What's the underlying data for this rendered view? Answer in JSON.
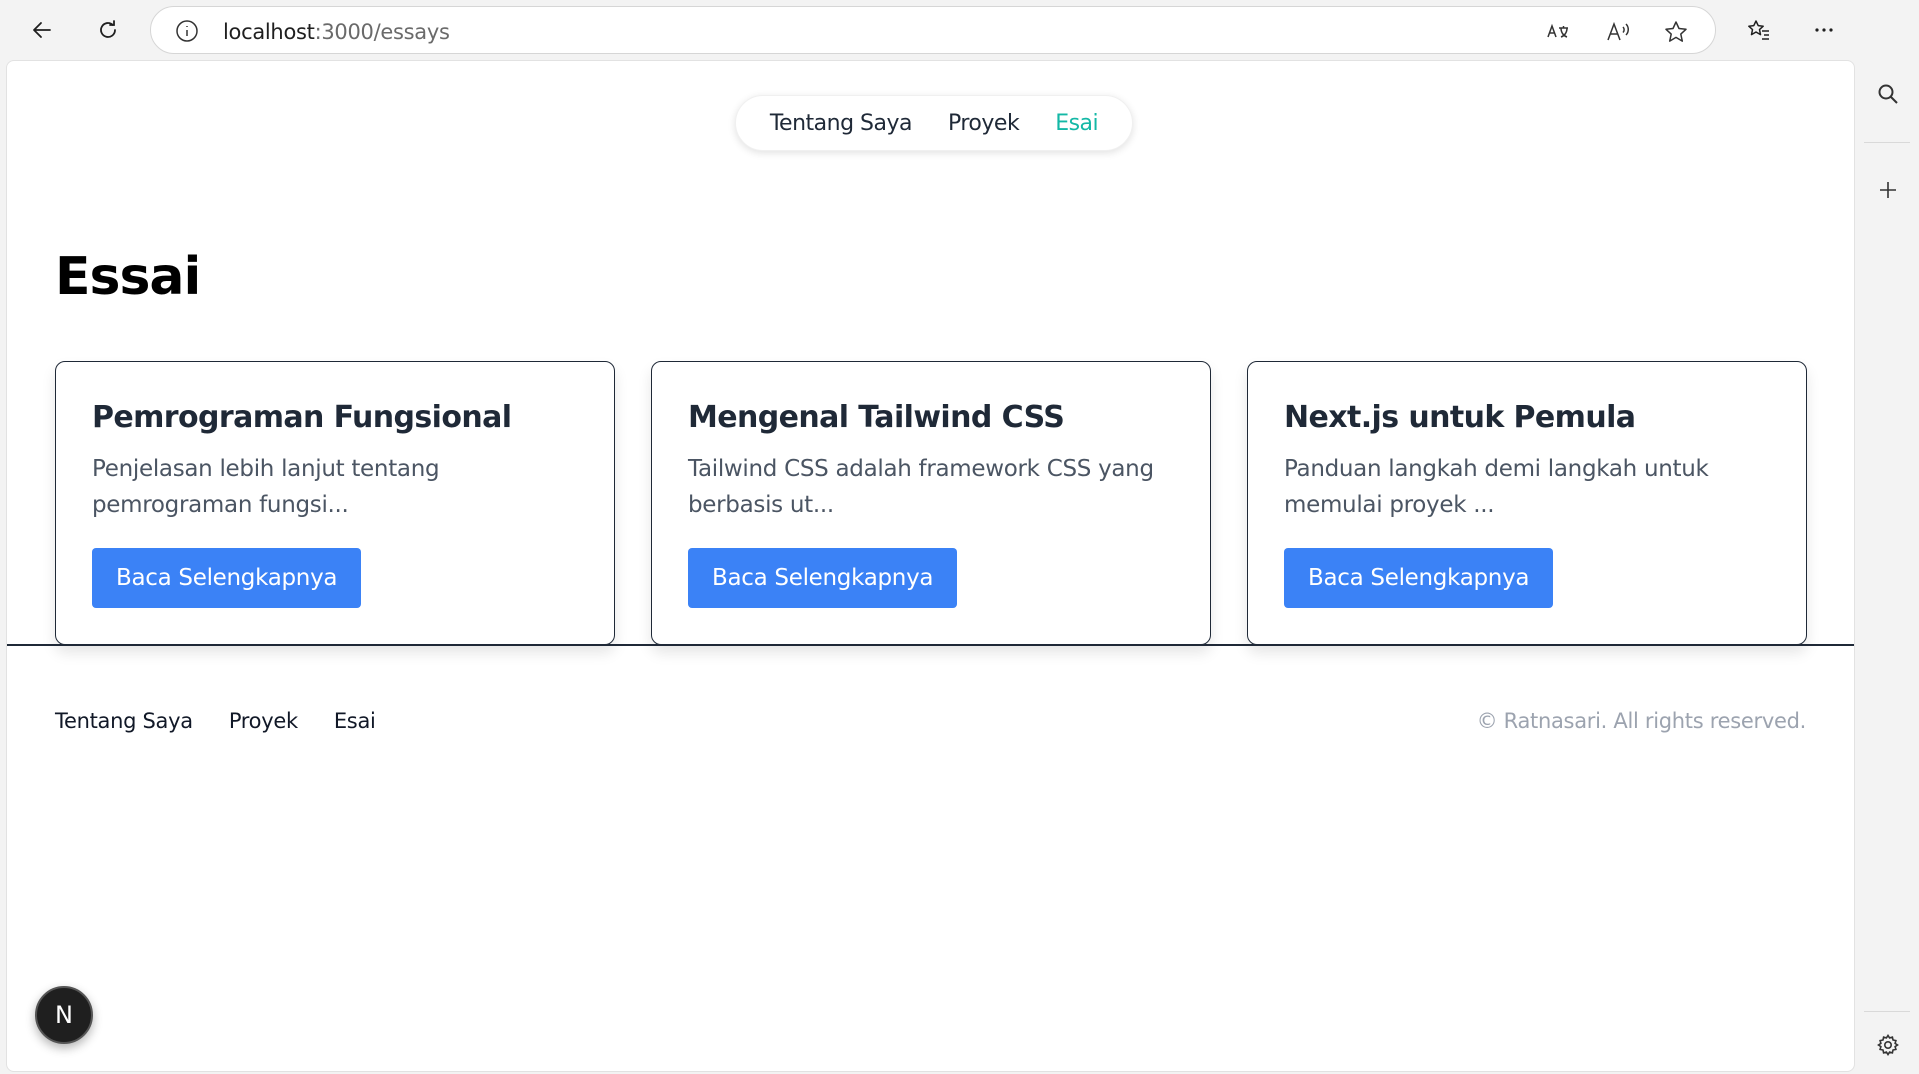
{
  "browser": {
    "url_host": "localhost",
    "url_path": ":3000/essays"
  },
  "nav": {
    "items": [
      {
        "label": "Tentang Saya",
        "active": false
      },
      {
        "label": "Proyek",
        "active": false
      },
      {
        "label": "Esai",
        "active": true
      }
    ],
    "active_color": "#14b8a6"
  },
  "page": {
    "title": "Essai"
  },
  "cards": [
    {
      "title": "Pemrograman Fungsional",
      "excerpt": "Penjelasan lebih lanjut tentang pemrograman fungsi...",
      "button": "Baca Selengkapnya"
    },
    {
      "title": "Mengenal Tailwind CSS",
      "excerpt": "Tailwind CSS adalah framework CSS yang berbasis ut...",
      "button": "Baca Selengkapnya"
    },
    {
      "title": "Next.js untuk Pemula",
      "excerpt": "Panduan langkah demi langkah untuk memulai proyek ...",
      "button": "Baca Selengkapnya"
    }
  ],
  "footer": {
    "links": [
      "Tentang Saya",
      "Proyek",
      "Esai"
    ],
    "copyright": "© Ratnasari. All rights reserved."
  },
  "badge": {
    "letter": "N"
  },
  "colors": {
    "button": "#3b82f6",
    "text": "#1f2937"
  }
}
